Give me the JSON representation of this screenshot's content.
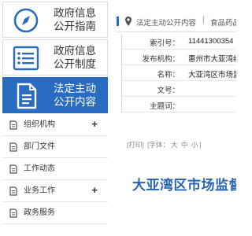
{
  "sidebar": {
    "tiles": [
      {
        "line1": "政府信息",
        "line2": "公开指南",
        "icon": "compass-icon",
        "active": false
      },
      {
        "line1": "政府信息",
        "line2": "公开制度",
        "icon": "list-icon",
        "active": false
      },
      {
        "line1": "法定主动",
        "line2": "公开内容",
        "icon": "document-icon",
        "active": true
      }
    ],
    "items": [
      {
        "label": "组织机构",
        "expand": "+"
      },
      {
        "label": "部门文件",
        "expand": ""
      },
      {
        "label": "工作动态",
        "expand": ""
      },
      {
        "label": "业务工作",
        "expand": "+"
      },
      {
        "label": "政务服务",
        "expand": ""
      }
    ]
  },
  "breadcrumb": {
    "item1": "法定主动公开内容",
    "separator": "|",
    "item2": "食品药品"
  },
  "meta": {
    "rows": [
      {
        "key": "索引号：",
        "value": "11441300354"
      },
      {
        "key": "发布机构：",
        "value": "惠州市大亚湾经"
      },
      {
        "key": "名称：",
        "value": "大亚湾区市场监"
      },
      {
        "key": "文号：",
        "value": ""
      },
      {
        "key": "主题词：",
        "value": ""
      }
    ]
  },
  "tools": {
    "print": "[打印]",
    "font_label": "[字体：",
    "large": "大",
    "medium": "中",
    "small": "小",
    "close_bracket": "]"
  },
  "document": {
    "title": "大亚湾区市场监督"
  },
  "colors": {
    "accent": "#2a6cc2",
    "title": "#2a63ad"
  }
}
